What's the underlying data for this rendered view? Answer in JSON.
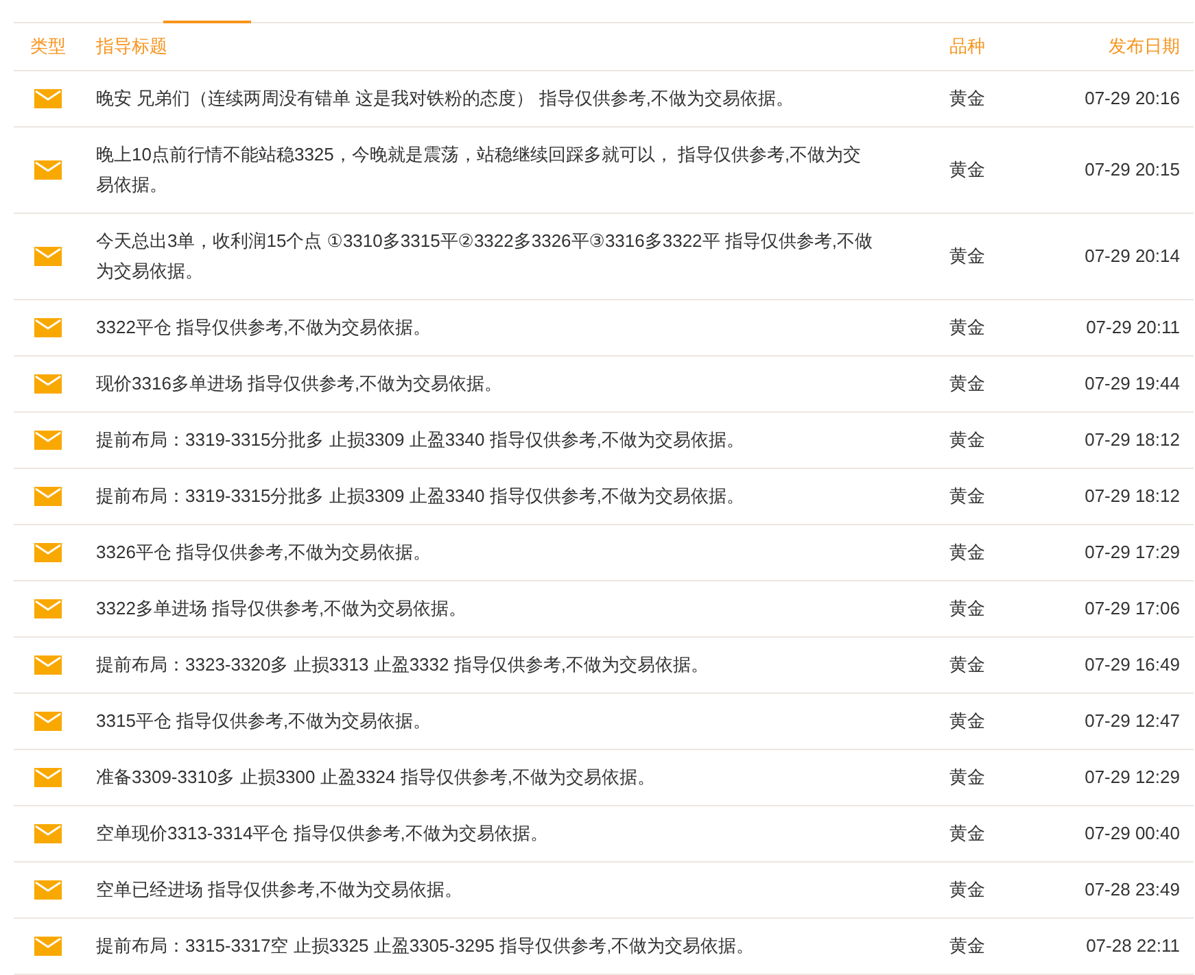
{
  "table": {
    "columns": [
      "类型",
      "指导标题",
      "品种",
      "发布日期"
    ],
    "rows": [
      {
        "title": "晚安 兄弟们（连续两周没有错单 这是我对铁粉的态度） 指导仅供参考,不做为交易依据。",
        "variety": "黄金",
        "date": "07-29 20:16"
      },
      {
        "title": "晚上10点前行情不能站稳3325，今晚就是震荡，站稳继续回踩多就可以， 指导仅供参考,不做为交易依据。",
        "variety": "黄金",
        "date": "07-29 20:15"
      },
      {
        "title": "今天总出3单，收利润15个点 ①3310多3315平②3322多3326平③3316多3322平 指导仅供参考,不做为交易依据。",
        "variety": "黄金",
        "date": "07-29 20:14"
      },
      {
        "title": "3322平仓 指导仅供参考,不做为交易依据。",
        "variety": "黄金",
        "date": "07-29 20:11"
      },
      {
        "title": "现价3316多单进场 指导仅供参考,不做为交易依据。",
        "variety": "黄金",
        "date": "07-29 19:44"
      },
      {
        "title": "提前布局：3319-3315分批多 止损3309 止盈3340 指导仅供参考,不做为交易依据。",
        "variety": "黄金",
        "date": "07-29 18:12"
      },
      {
        "title": "提前布局：3319-3315分批多 止损3309 止盈3340 指导仅供参考,不做为交易依据。",
        "variety": "黄金",
        "date": "07-29 18:12"
      },
      {
        "title": "3326平仓 指导仅供参考,不做为交易依据。",
        "variety": "黄金",
        "date": "07-29 17:29"
      },
      {
        "title": "3322多单进场 指导仅供参考,不做为交易依据。",
        "variety": "黄金",
        "date": "07-29 17:06"
      },
      {
        "title": "提前布局：3323-3320多 止损3313 止盈3332 指导仅供参考,不做为交易依据。",
        "variety": "黄金",
        "date": "07-29 16:49"
      },
      {
        "title": "3315平仓 指导仅供参考,不做为交易依据。",
        "variety": "黄金",
        "date": "07-29 12:47"
      },
      {
        "title": "准备3309-3310多 止损3300 止盈3324 指导仅供参考,不做为交易依据。",
        "variety": "黄金",
        "date": "07-29 12:29"
      },
      {
        "title": "空单现价3313-3314平仓 指导仅供参考,不做为交易依据。",
        "variety": "黄金",
        "date": "07-29 00:40"
      },
      {
        "title": "空单已经进场 指导仅供参考,不做为交易依据。",
        "variety": "黄金",
        "date": "07-28 23:49"
      },
      {
        "title": "提前布局：3315-3317空 止损3325 止盈3305-3295 指导仅供参考,不做为交易依据。",
        "variety": "黄金",
        "date": "07-28 22:11"
      }
    ]
  }
}
